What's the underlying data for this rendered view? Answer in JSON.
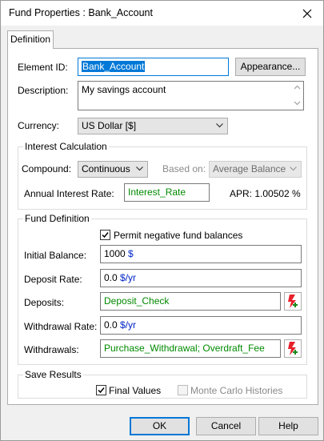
{
  "window": {
    "title": "Fund Properties : Bank_Account",
    "close_label": "✕"
  },
  "tabs": [
    {
      "label": "Definition"
    }
  ],
  "element_id": {
    "label": "Element ID:",
    "value": "Bank_Account"
  },
  "appearance_button": "Appearance...",
  "description": {
    "label": "Description:",
    "value": "My savings account"
  },
  "currency": {
    "label": "Currency:",
    "value": "US Dollar [$]"
  },
  "interest": {
    "group_title": "Interest Calculation",
    "compound_label": "Compound:",
    "compound_value": "Continuous",
    "based_on_label": "Based on:",
    "based_on_value": "Average Balance",
    "rate_label": "Annual Interest Rate:",
    "rate_value": "Interest_Rate",
    "apr_text": "APR: 1.00502 %"
  },
  "fund": {
    "group_title": "Fund Definition",
    "permit_negative_label": "Permit negative fund balances",
    "permit_negative_checked": true,
    "initial_balance": {
      "label": "Initial Balance:",
      "value": "1000",
      "unit": "$"
    },
    "deposit_rate": {
      "label": "Deposit Rate:",
      "value": "0.0",
      "unit": "$/yr"
    },
    "deposits": {
      "label": "Deposits:",
      "value": "Deposit_Check"
    },
    "withdrawal_rate": {
      "label": "Withdrawal Rate:",
      "value": "0.0",
      "unit": "$/yr"
    },
    "withdrawals": {
      "label": "Withdrawals:",
      "value": "Purchase_Withdrawal; Overdraft_Fee"
    }
  },
  "save_results": {
    "group_title": "Save Results",
    "final_values_label": "Final Values",
    "final_values_checked": true,
    "monte_carlo_label": "Monte Carlo Histories",
    "monte_carlo_checked": false
  },
  "buttons": {
    "ok": "OK",
    "cancel": "Cancel",
    "help": "Help"
  },
  "colors": {
    "expression_text": "#008a00",
    "unit_text": "#0026c8",
    "edit_icon": "#e8202a"
  },
  "icons": [
    "close-icon",
    "chevron-down-icon",
    "checkmark-icon",
    "edit-expression-icon"
  ]
}
